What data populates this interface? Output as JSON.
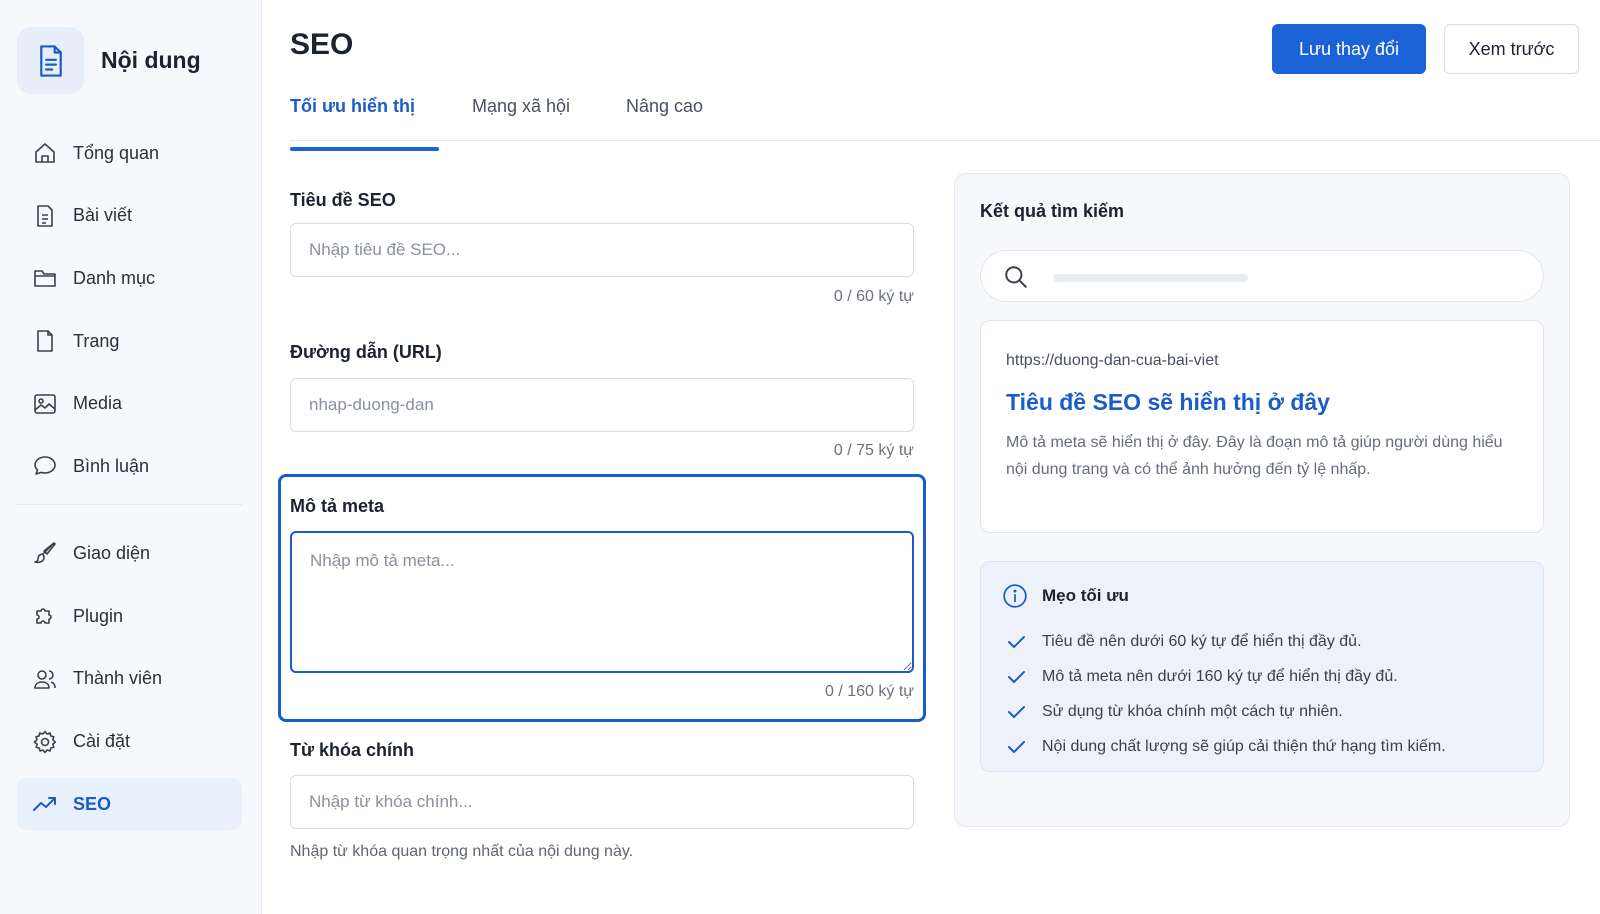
{
  "sidebar": {
    "brand_title": "Nội dung",
    "items": [
      {
        "label": "Tổng quan",
        "icon": "home-icon"
      },
      {
        "label": "Bài viết",
        "icon": "document-icon"
      },
      {
        "label": "Danh mục",
        "icon": "folder-icon"
      },
      {
        "label": "Trang",
        "icon": "page-icon"
      },
      {
        "label": "Media",
        "icon": "image-icon"
      },
      {
        "label": "Bình luận",
        "icon": "comment-icon"
      },
      {
        "label": "Giao diện",
        "icon": "brush-icon"
      },
      {
        "label": "Plugin",
        "icon": "puzzle-icon"
      },
      {
        "label": "Thành viên",
        "icon": "users-icon"
      },
      {
        "label": "Cài đặt",
        "icon": "gear-icon"
      },
      {
        "label": "SEO",
        "icon": "trend-icon",
        "active": true
      }
    ]
  },
  "header": {
    "title": "SEO",
    "save_label": "Lưu thay đổi",
    "preview_label": "Xem trước"
  },
  "tabs": [
    {
      "label": "Tối ưu hiển thị",
      "active": true
    },
    {
      "label": "Mạng xã hội"
    },
    {
      "label": "Nâng cao"
    }
  ],
  "form": {
    "seo_title": {
      "label": "Tiêu đề SEO",
      "placeholder": "Nhập tiêu đề SEO...",
      "value": "",
      "counter": "0 / 60 ký tự"
    },
    "url": {
      "label": "Đường dẫn (URL)",
      "placeholder": "nhap-duong-dan",
      "value": "",
      "counter": "0 / 75 ký tự"
    },
    "meta": {
      "label": "Mô tả meta",
      "placeholder": "Nhập mô tả meta...",
      "value": "",
      "counter": "0 / 160 ký tự"
    },
    "keyword": {
      "label": "Từ khóa chính",
      "placeholder": "Nhập từ khóa chính...",
      "value": "",
      "help": "Nhập từ khóa quan trọng nhất của nội dung này."
    }
  },
  "preview": {
    "title": "Kết quả tìm kiếm",
    "result": {
      "url": "https://duong-dan-cua-bai-viet",
      "title": "Tiêu đề SEO sẽ hiển thị ở đây",
      "description": "Mô tả meta sẽ hiển thị ở đây. Đây là đoạn mô tả giúp người dùng hiểu nội dung trang và có thể ảnh hưởng đến tỷ lệ nhấp."
    },
    "tips": {
      "title": "Mẹo tối ưu",
      "items": [
        "Tiêu đề nên dưới 60 ký tự để hiển thị đầy đủ.",
        "Mô tả meta nên dưới 160 ký tự để hiển thị đầy đủ.",
        "Sử dụng từ khóa chính một cách tự nhiên.",
        "Nội dung chất lượng sẽ giúp cải thiện thứ hạng tìm kiếm."
      ]
    }
  },
  "colors": {
    "accent": "#1a62d6",
    "link": "#1a5cc8",
    "sidebar_bg": "#f6f8fb"
  }
}
